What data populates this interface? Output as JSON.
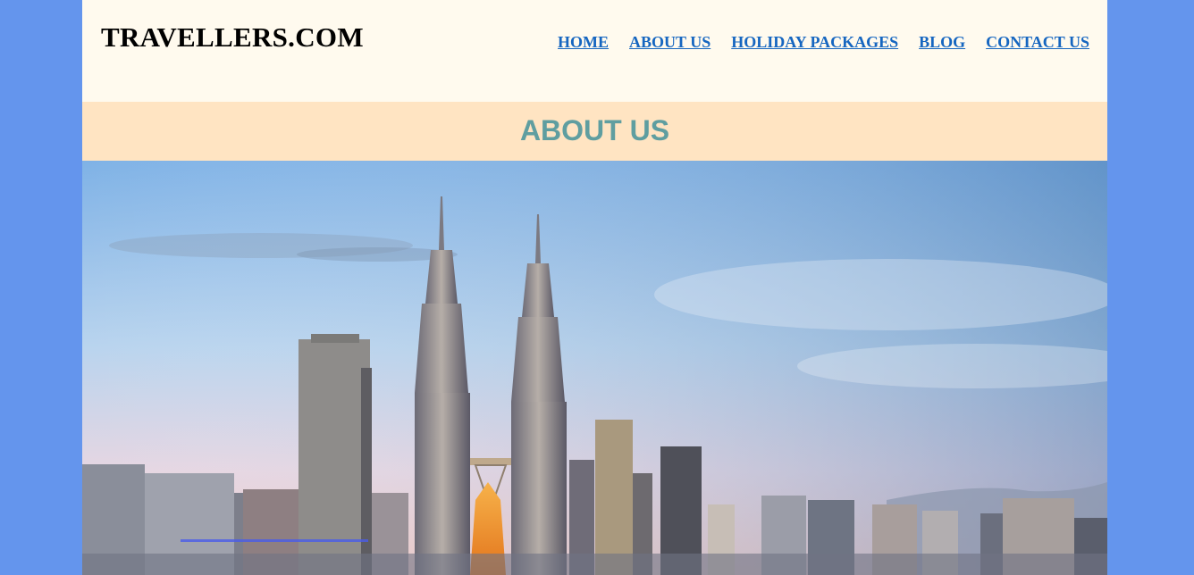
{
  "site": {
    "logo": "TRAVELLERS.COM"
  },
  "nav": {
    "items": [
      {
        "label": "HOME"
      },
      {
        "label": "ABOUT US"
      },
      {
        "label": "HOLIDAY PACKAGES"
      },
      {
        "label": "BLOG"
      },
      {
        "label": "CONTACT US"
      }
    ]
  },
  "banner": {
    "title": "ABOUT US"
  },
  "hero": {
    "image": "city-skyline-twin-towers-image"
  },
  "colors": {
    "page_background": "#6495ED",
    "header_background": "#FFFAEE",
    "banner_background": "#FFE4C2",
    "banner_text": "#5F9EA0",
    "nav_link": "#1666C0"
  }
}
